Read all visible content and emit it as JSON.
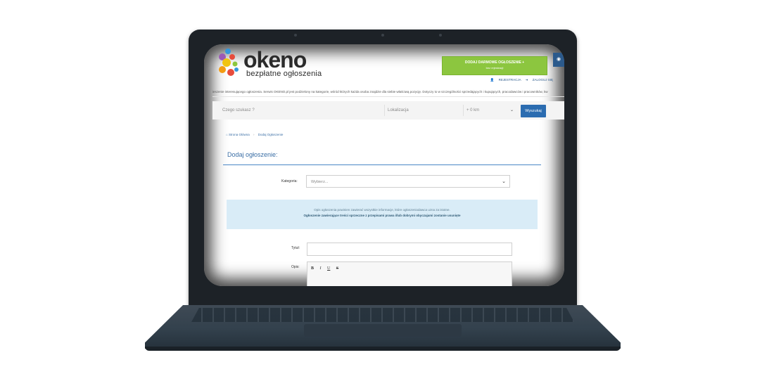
{
  "brand": {
    "name": "okeno",
    "tagline": "bezpłatne ogłoszenia",
    "colors": [
      "#e74c3c",
      "#f39c12",
      "#f1c40f",
      "#8cc63f",
      "#3498db",
      "#9b59b6"
    ]
  },
  "header": {
    "add_button_main": "DODAJ DARMOWE OGŁOSZENIE +",
    "add_button_sub": "bez rejestracji",
    "register_link": "REJESTRACJA",
    "login_link": "ZALOGUJ SIĘ",
    "intro_text": "ieszenie interesującego ogłoszenia. Serwis OKENO.pl jest podzielony na kategorie, wśród których każda osoba znajdzie dla siebie właściwą pozycję. Dotyczy to w szczególności sprzedających i kupujących, pracodawców i pracowników, kw"
  },
  "search": {
    "query_placeholder": "Czego szukasz ?",
    "location_placeholder": "Lokalizacja",
    "distance_value": "+ 0 km",
    "button_label": "Wyszukaj"
  },
  "breadcrumb": {
    "home": "Strona Główna",
    "current": "Dodaj Ogłoszenie"
  },
  "form": {
    "heading": "Dodaj ogłoszenie:",
    "category_label": "Kategoria:",
    "category_value": "Wybierz...",
    "info_line1": "Opis ogłoszenia powinien zawierać wszystkie informacje, które ogłoszeniodawca uzna za istotne.",
    "info_line2": "Ogłoszenie zawierające treści sprzeczne z przepisami prawa i/lub dobrymi obyczajami zostanie usunięte",
    "title_label": "Tytuł:",
    "description_label": "Opis:",
    "toolbar": [
      "B",
      "I",
      "U",
      "S"
    ]
  },
  "accent_colors": {
    "green_button": "#8cc63f",
    "blue_button": "#2b6cb0",
    "info_bg": "#d9ecf7",
    "link_blue": "#3a6ea5"
  }
}
